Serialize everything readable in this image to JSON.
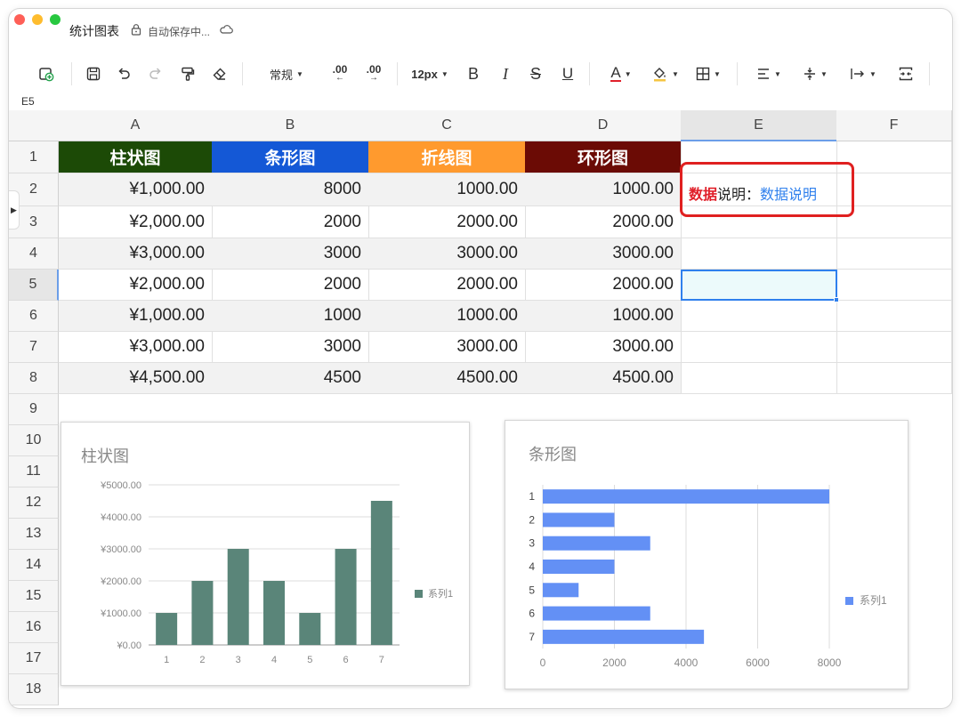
{
  "window": {
    "doc_title": "统计图表",
    "save_status": "自动保存中...",
    "cell_ref": "E5"
  },
  "toolbar": {
    "format_label": "常规",
    "decimal_dec": ".00",
    "decimal_inc": ".00",
    "font_size": "12px",
    "bold": "B",
    "italic": "I",
    "strike": "S",
    "underline": "U",
    "font_color": "A"
  },
  "columns": [
    "A",
    "B",
    "C",
    "D",
    "E",
    "F"
  ],
  "rows": [
    "1",
    "2",
    "3",
    "4",
    "5",
    "6",
    "7",
    "8",
    "9",
    "10",
    "11",
    "12",
    "13",
    "14",
    "15",
    "16",
    "17",
    "18"
  ],
  "table": {
    "headers": [
      {
        "text": "柱状图",
        "color": "#1c4a06"
      },
      {
        "text": "条形图",
        "color": "#1458d6"
      },
      {
        "text": "折线图",
        "color": "#ff9a2e"
      },
      {
        "text": "环形图",
        "color": "#6b0b05"
      }
    ],
    "rows": [
      [
        "¥1,000.00",
        "8000",
        "1000.00",
        "1000.00"
      ],
      [
        "¥2,000.00",
        "2000",
        "2000.00",
        "2000.00"
      ],
      [
        "¥3,000.00",
        "3000",
        "3000.00",
        "3000.00"
      ],
      [
        "¥2,000.00",
        "2000",
        "2000.00",
        "2000.00"
      ],
      [
        "¥1,000.00",
        "1000",
        "1000.00",
        "1000.00"
      ],
      [
        "¥3,000.00",
        "3000",
        "3000.00",
        "3000.00"
      ],
      [
        "¥4,500.00",
        "4500",
        "4500.00",
        "4500.00"
      ]
    ]
  },
  "note": {
    "bold": "数据",
    "plain": "说明：",
    "link": "数据说明"
  },
  "chart_data": [
    {
      "type": "bar",
      "title": "柱状图",
      "categories": [
        "1",
        "2",
        "3",
        "4",
        "5",
        "6",
        "7"
      ],
      "series": [
        {
          "name": "系列1",
          "values": [
            1000,
            2000,
            3000,
            2000,
            1000,
            3000,
            4500
          ],
          "color": "#5a8579"
        }
      ],
      "y_ticks": [
        "¥0.00",
        "¥1000.00",
        "¥2000.00",
        "¥3000.00",
        "¥4000.00",
        "¥5000.00"
      ],
      "ylim": [
        0,
        5000
      ],
      "grid": true,
      "legend": "right"
    },
    {
      "type": "bar",
      "orientation": "horizontal",
      "title": "条形图",
      "categories": [
        "1",
        "2",
        "3",
        "4",
        "5",
        "6",
        "7"
      ],
      "series": [
        {
          "name": "系列1",
          "values": [
            8000,
            2000,
            3000,
            2000,
            1000,
            3000,
            4500
          ],
          "color": "#6390f5"
        }
      ],
      "x_ticks": [
        "0",
        "2000",
        "4000",
        "6000",
        "8000"
      ],
      "xlim": [
        0,
        8000
      ],
      "grid": true,
      "legend": "right"
    }
  ]
}
